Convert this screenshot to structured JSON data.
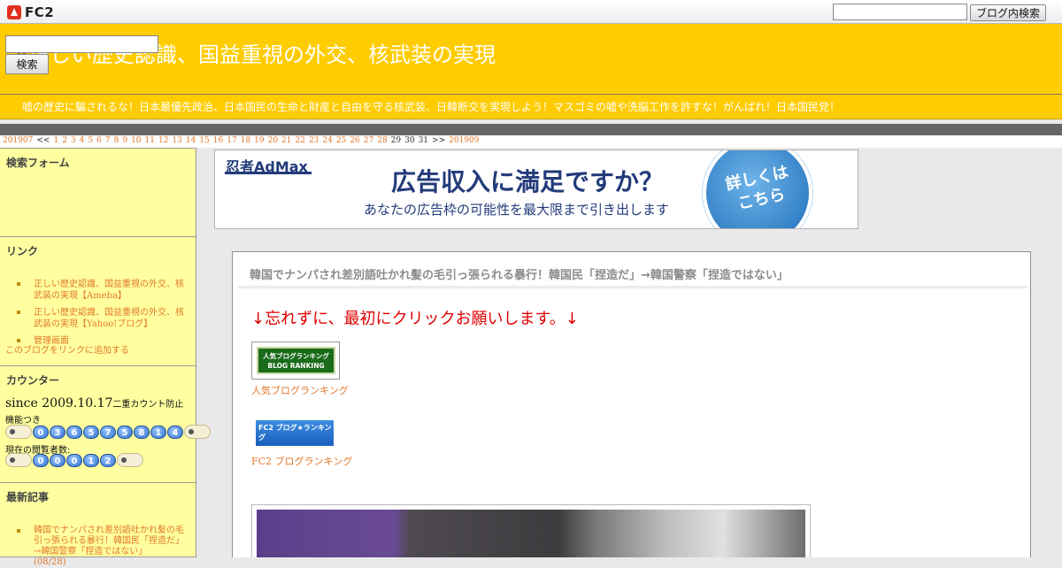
{
  "fc2bar": {
    "logo_text": "FC2",
    "search_placeholder": "",
    "search_button": "ブログ内検索"
  },
  "header": {
    "title": "正しい歴史認識、国益重視の外交、核武装の実現",
    "intro": "嘘の歴史に騙されるな！日本最優先政治、日本国民の生命と財産と自由を守る核武装、日韓断交を実現しよう！マスゴミの嘘や洗脳工作を許すな！がんばれ！日本国民党！"
  },
  "calendar": {
    "prev": "201907",
    "prev_arrow": "<<",
    "linked_days": [
      "1",
      "2",
      "3",
      "4",
      "5",
      "6",
      "7",
      "8",
      "9",
      "10",
      "11",
      "12",
      "13",
      "14",
      "15",
      "16",
      "17",
      "18",
      "19",
      "20",
      "21",
      "22",
      "23",
      "24",
      "25",
      "26",
      "27",
      "28"
    ],
    "plain_days": [
      "29",
      "30",
      "31"
    ],
    "next_arrow": ">>",
    "next": "201909"
  },
  "sidebar": {
    "search": {
      "heading": "検索フォーム",
      "button": "検索"
    },
    "links": {
      "heading": "リンク",
      "items": [
        "正しい歴史認識、国益重視の外交、核武装の実現【Ameba】",
        "正しい歴史認識、国益重視の外交、核武装の実現【Yahoo!ブログ】",
        "管理画面"
      ],
      "add_link": "このブログをリンクに追加する"
    },
    "counter": {
      "heading": "カウンター",
      "since": "since 2009.10.17",
      "since_note": "二重カウント防止機能つき",
      "total_digits": [
        "0",
        "3",
        "6",
        "5",
        "7",
        "5",
        "8",
        "1",
        "4"
      ],
      "viewers_label": "現在の閲覧者数:",
      "viewer_digits": [
        "0",
        "0",
        "0",
        "1",
        "2"
      ]
    },
    "recent": {
      "heading": "最新記事",
      "items": [
        {
          "title": "韓国でナンパされ差別語吐かれ髪の毛引っ張られる暴行！韓国民「捏造だ」→韓国警察「捏造ではない」",
          "date": "(08/28)"
        }
      ]
    }
  },
  "ad": {
    "brand": "忍者AdMax",
    "headline": "広告収入に満足ですか？",
    "sub": "あなたの広告枠の可能性を最大限まで引き出します",
    "cta": "詳しくはこちら"
  },
  "entry": {
    "title": "韓国でナンパされ差別語吐かれ髪の毛引っ張られる暴行！韓国民「捏造だ」→韓国警察「捏造ではない」",
    "request": "↓忘れずに、最初にクリックお願いします。↓",
    "rank1_banner": "人気ブログランキング BLOG RANKING",
    "rank1_link": "人気ブログランキング",
    "rank2_banner": "FC2 ブログ★ランキング",
    "rank2_link": "FC2 ブログランキング"
  },
  "colors": {
    "header_bg": "#ffcc00",
    "sidebar_bg": "#ffffa0",
    "link": "#e2782a",
    "request_red": "#e00000"
  }
}
